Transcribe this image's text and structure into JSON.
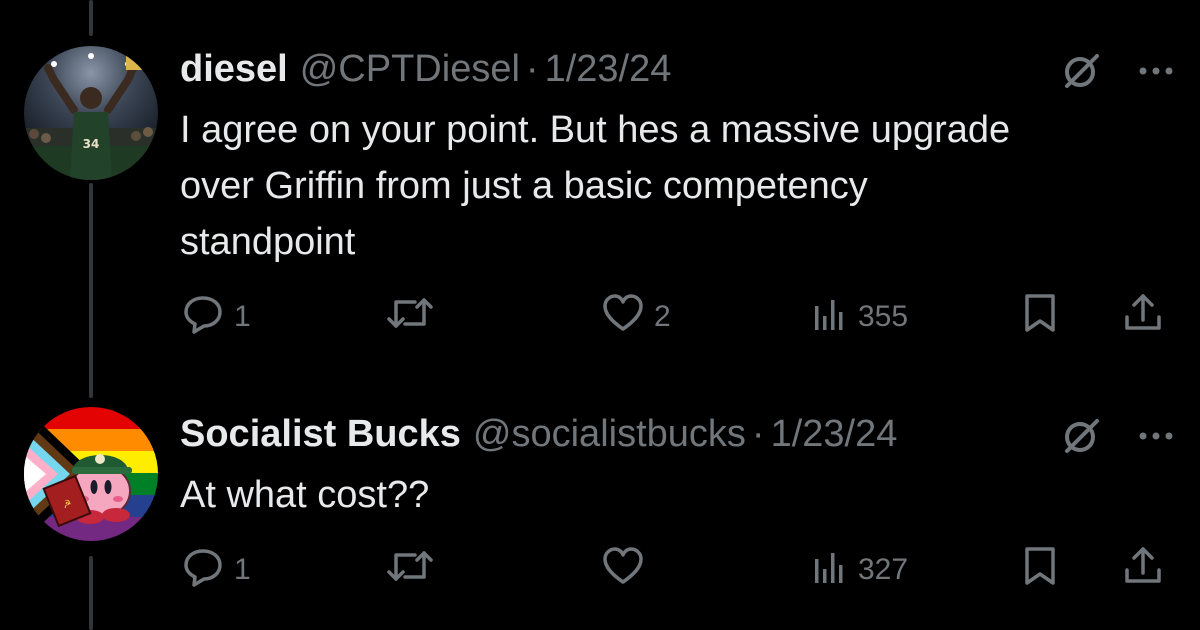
{
  "tweets": [
    {
      "display_name": "diesel",
      "handle": "@CPTDiesel",
      "separator": "·",
      "date": "1/23/24",
      "text_lines": [
        "I agree on your point. But hes a massive upgrade",
        "over Griffin from just a basic competency",
        "standpoint"
      ],
      "replies": "1",
      "retweets": "",
      "likes": "2",
      "views": "355"
    },
    {
      "display_name": "Socialist Bucks",
      "handle": "@socialistbucks",
      "separator": "·",
      "date": "1/23/24",
      "text_lines": [
        "At what cost??"
      ],
      "replies": "1",
      "retweets": "",
      "likes": "",
      "views": "327"
    }
  ],
  "icons": {
    "reply": "reply-icon",
    "retweet": "retweet-icon",
    "like": "heart-icon",
    "views": "views-icon",
    "bookmark": "bookmark-icon",
    "share": "share-icon",
    "grok": "grok-icon",
    "more": "more-icon"
  },
  "colors": {
    "background": "#000000",
    "text": "#e7e9ea",
    "secondary": "#71767b",
    "thread_line": "#333639"
  }
}
